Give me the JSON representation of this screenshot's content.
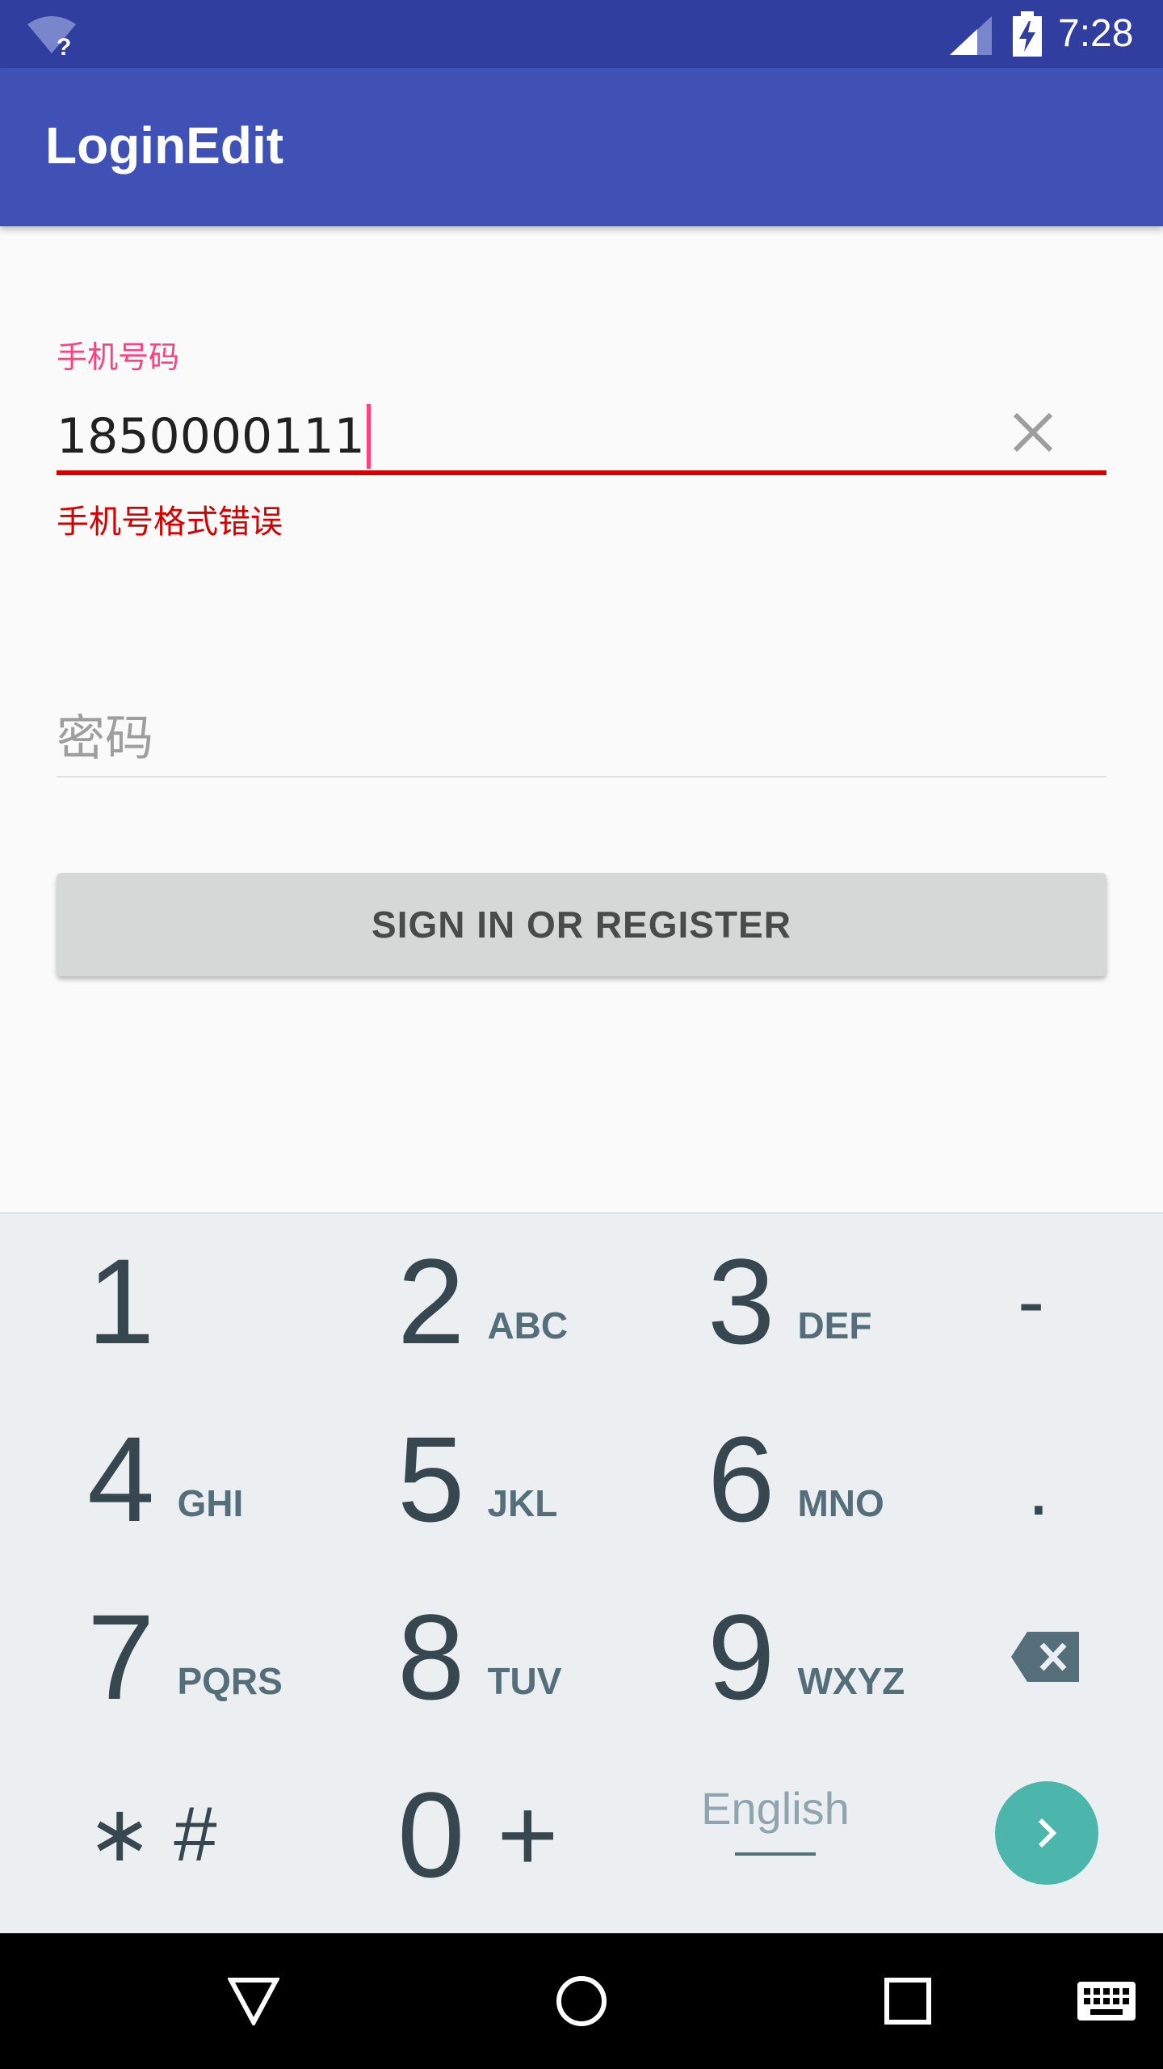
{
  "status_bar": {
    "time": "7:28",
    "icons": [
      "wifi-unknown-icon",
      "cell-signal-icon",
      "battery-charging-icon"
    ]
  },
  "app_bar": {
    "title": "LoginEdit"
  },
  "form": {
    "phone_label": "手机号码",
    "phone_value": "1850000111",
    "phone_error": "手机号格式错误",
    "password_placeholder": "密码",
    "sign_in_button": "SIGN IN OR REGISTER",
    "colors": {
      "accent": "#ff4081",
      "error": "#d50000",
      "primary": "#3f51b5",
      "primary_dark": "#303f9f"
    }
  },
  "keyboard": {
    "keys": [
      {
        "num": "1",
        "letters": ""
      },
      {
        "num": "2",
        "letters": "ABC"
      },
      {
        "num": "3",
        "letters": "DEF"
      },
      {
        "num": "-",
        "letters": ""
      },
      {
        "num": "4",
        "letters": "GHI"
      },
      {
        "num": "5",
        "letters": "JKL"
      },
      {
        "num": "6",
        "letters": "MNO"
      },
      {
        "num": ".",
        "letters": ""
      },
      {
        "num": "7",
        "letters": "PQRS"
      },
      {
        "num": "8",
        "letters": "TUV"
      },
      {
        "num": "9",
        "letters": "WXYZ"
      }
    ],
    "star_hash": "∗ #",
    "zero": "0",
    "plus": "+",
    "language": "English",
    "go_color": "#4db6ac"
  },
  "nav_bar": {
    "icons": [
      "back-icon",
      "home-icon",
      "recents-icon",
      "keyboard-icon"
    ]
  }
}
